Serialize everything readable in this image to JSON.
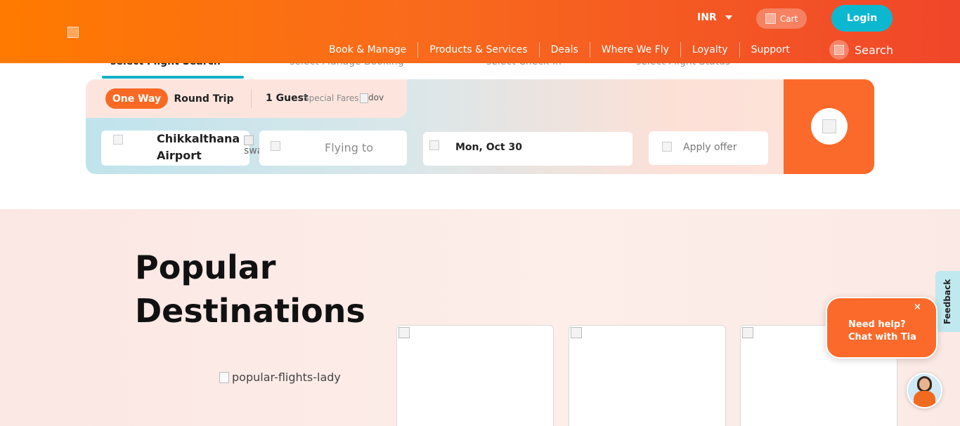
{
  "header": {
    "currency": "INR",
    "cart_label": "Cart",
    "login_label": "Login",
    "nav": [
      "Book & Manage",
      "Products & Services",
      "Deals",
      "Where We Fly",
      "Loyalty",
      "Support"
    ],
    "search_label": "Search"
  },
  "tabs": [
    {
      "label": "select  Flight Search",
      "active": true
    },
    {
      "label": "select  Manage Booking",
      "active": false
    },
    {
      "label": "select  Check-in",
      "active": false
    },
    {
      "label": "select  Flight Status",
      "active": false
    }
  ],
  "booking": {
    "trip_types": [
      "One Way",
      "Round Trip"
    ],
    "selected_trip": "One Way",
    "guests": "1 Guest",
    "special_fares": "Special Fares",
    "dropdown_alt": "dov",
    "from": "Chikkalthana Airport",
    "swap_alt": "swap",
    "to_placeholder": "Flying to",
    "date": "Mon, Oct 30",
    "offer_placeholder": "Apply offer",
    "search_alt": "Search"
  },
  "popular": {
    "title": "Popular Destinations",
    "lady_alt": "popular-flights-lady"
  },
  "feedback_label": "Feedback",
  "chat": {
    "line1": "Need help?",
    "line2": "Chat with Tia",
    "close": "×"
  },
  "colors": {
    "brand_orange": "#fb6a2a",
    "login_teal": "#0cb8d0",
    "active_tab": "#14b1c5"
  }
}
